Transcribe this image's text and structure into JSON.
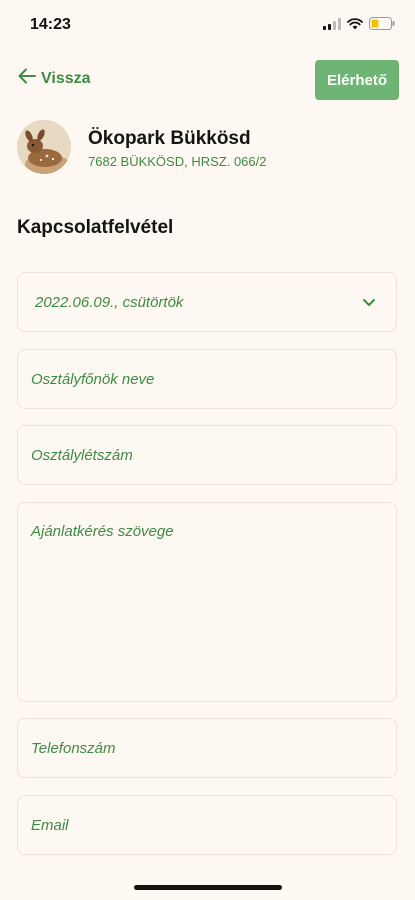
{
  "status_bar": {
    "time": "14:23",
    "icons": [
      "cellular-signal-icon",
      "wifi-icon",
      "battery-icon"
    ]
  },
  "header": {
    "back_label": "Vissza",
    "available_label": "Elérhető"
  },
  "profile": {
    "name": "Ökopark Bükkösd",
    "address": "7682 BÜKKÖSD, HRSZ. 066/2",
    "avatar_icon": "fawn-photo"
  },
  "form": {
    "title": "Kapcsolatfelvétel",
    "date_value": "2022.06.09., csütörtök",
    "teacher_placeholder": "Osztályfőnök neve",
    "class_size_placeholder": "Osztálylétszám",
    "request_placeholder": "Ajánlatkérés szövege",
    "phone_placeholder": "Telefonszám",
    "email_placeholder": "Email"
  },
  "colors": {
    "accent_green": "#3f8a45",
    "button_green": "#6eb472",
    "background": "#fdf8f1",
    "field_border": "#ece4d6"
  }
}
